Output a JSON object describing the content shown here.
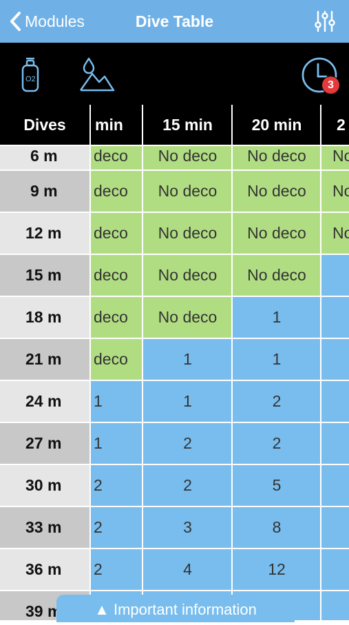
{
  "navbar": {
    "back_label": "Modules",
    "title": "Dive Table",
    "settings_icon": "sliders-icon"
  },
  "toolbar": {
    "o2_icon": "oxygen-tank-icon",
    "o2_label": "O2",
    "altitude_icon": "altitude-water-mountain-icon",
    "history_icon": "clock-icon",
    "badge_count": "3"
  },
  "table": {
    "corner_label": "Dives",
    "columns": [
      "min",
      "15 min",
      "20 min",
      "2"
    ],
    "rows": [
      {
        "depth": "6 m",
        "values": [
          "deco",
          "No deco",
          "No deco",
          "No"
        ],
        "colors": [
          "green",
          "green",
          "green",
          "green"
        ]
      },
      {
        "depth": "9 m",
        "values": [
          "deco",
          "No deco",
          "No deco",
          "No"
        ],
        "colors": [
          "green",
          "green",
          "green",
          "green"
        ]
      },
      {
        "depth": "12 m",
        "values": [
          "deco",
          "No deco",
          "No deco",
          "No"
        ],
        "colors": [
          "green",
          "green",
          "green",
          "green"
        ]
      },
      {
        "depth": "15 m",
        "values": [
          "deco",
          "No deco",
          "No deco",
          ""
        ],
        "colors": [
          "green",
          "green",
          "green",
          "blue"
        ]
      },
      {
        "depth": "18 m",
        "values": [
          "deco",
          "No deco",
          "1",
          ""
        ],
        "colors": [
          "green",
          "green",
          "blue",
          "blue"
        ]
      },
      {
        "depth": "21 m",
        "values": [
          "deco",
          "1",
          "1",
          ""
        ],
        "colors": [
          "green",
          "blue",
          "blue",
          "blue"
        ]
      },
      {
        "depth": "24 m",
        "values": [
          "1",
          "1",
          "2",
          ""
        ],
        "colors": [
          "blue",
          "blue",
          "blue",
          "blue"
        ]
      },
      {
        "depth": "27 m",
        "values": [
          "1",
          "2",
          "2",
          ""
        ],
        "colors": [
          "blue",
          "blue",
          "blue",
          "blue"
        ]
      },
      {
        "depth": "30 m",
        "values": [
          "2",
          "2",
          "5",
          ""
        ],
        "colors": [
          "blue",
          "blue",
          "blue",
          "blue"
        ]
      },
      {
        "depth": "33 m",
        "values": [
          "2",
          "3",
          "8",
          ""
        ],
        "colors": [
          "blue",
          "blue",
          "blue",
          "blue"
        ]
      },
      {
        "depth": "36 m",
        "values": [
          "2",
          "4",
          "12",
          ""
        ],
        "colors": [
          "blue",
          "blue",
          "blue",
          "blue"
        ]
      },
      {
        "depth": "39 m",
        "values": [
          "",
          "",
          "",
          ""
        ],
        "colors": [
          "blue",
          "blue",
          "blue",
          "blue"
        ]
      }
    ]
  },
  "footer": {
    "info_label": "▲ Important information"
  },
  "colors": {
    "navbar_bg": "#6fb1e6",
    "toolbar_bg": "#000000",
    "no_deco_green": "#b1dd82",
    "deco_blue": "#78bdee",
    "badge_red": "#e5393b"
  }
}
